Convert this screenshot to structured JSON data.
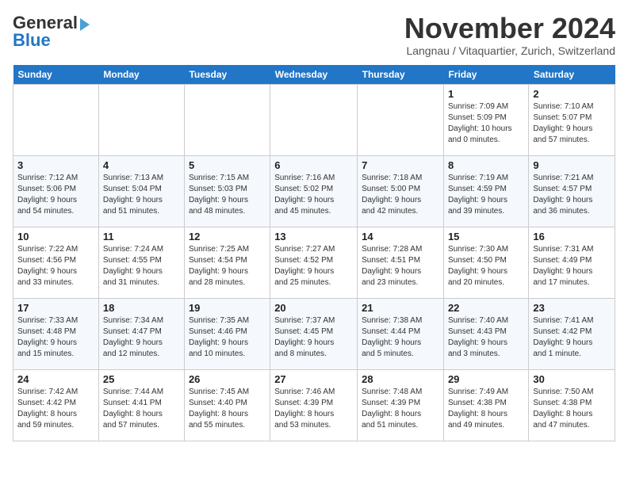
{
  "header": {
    "logo_line1": "General",
    "logo_line2": "Blue",
    "month": "November 2024",
    "location": "Langnau / Vitaquartier, Zurich, Switzerland"
  },
  "days_of_week": [
    "Sunday",
    "Monday",
    "Tuesday",
    "Wednesday",
    "Thursday",
    "Friday",
    "Saturday"
  ],
  "weeks": [
    [
      {
        "num": "",
        "info": ""
      },
      {
        "num": "",
        "info": ""
      },
      {
        "num": "",
        "info": ""
      },
      {
        "num": "",
        "info": ""
      },
      {
        "num": "",
        "info": ""
      },
      {
        "num": "1",
        "info": "Sunrise: 7:09 AM\nSunset: 5:09 PM\nDaylight: 10 hours\nand 0 minutes."
      },
      {
        "num": "2",
        "info": "Sunrise: 7:10 AM\nSunset: 5:07 PM\nDaylight: 9 hours\nand 57 minutes."
      }
    ],
    [
      {
        "num": "3",
        "info": "Sunrise: 7:12 AM\nSunset: 5:06 PM\nDaylight: 9 hours\nand 54 minutes."
      },
      {
        "num": "4",
        "info": "Sunrise: 7:13 AM\nSunset: 5:04 PM\nDaylight: 9 hours\nand 51 minutes."
      },
      {
        "num": "5",
        "info": "Sunrise: 7:15 AM\nSunset: 5:03 PM\nDaylight: 9 hours\nand 48 minutes."
      },
      {
        "num": "6",
        "info": "Sunrise: 7:16 AM\nSunset: 5:02 PM\nDaylight: 9 hours\nand 45 minutes."
      },
      {
        "num": "7",
        "info": "Sunrise: 7:18 AM\nSunset: 5:00 PM\nDaylight: 9 hours\nand 42 minutes."
      },
      {
        "num": "8",
        "info": "Sunrise: 7:19 AM\nSunset: 4:59 PM\nDaylight: 9 hours\nand 39 minutes."
      },
      {
        "num": "9",
        "info": "Sunrise: 7:21 AM\nSunset: 4:57 PM\nDaylight: 9 hours\nand 36 minutes."
      }
    ],
    [
      {
        "num": "10",
        "info": "Sunrise: 7:22 AM\nSunset: 4:56 PM\nDaylight: 9 hours\nand 33 minutes."
      },
      {
        "num": "11",
        "info": "Sunrise: 7:24 AM\nSunset: 4:55 PM\nDaylight: 9 hours\nand 31 minutes."
      },
      {
        "num": "12",
        "info": "Sunrise: 7:25 AM\nSunset: 4:54 PM\nDaylight: 9 hours\nand 28 minutes."
      },
      {
        "num": "13",
        "info": "Sunrise: 7:27 AM\nSunset: 4:52 PM\nDaylight: 9 hours\nand 25 minutes."
      },
      {
        "num": "14",
        "info": "Sunrise: 7:28 AM\nSunset: 4:51 PM\nDaylight: 9 hours\nand 23 minutes."
      },
      {
        "num": "15",
        "info": "Sunrise: 7:30 AM\nSunset: 4:50 PM\nDaylight: 9 hours\nand 20 minutes."
      },
      {
        "num": "16",
        "info": "Sunrise: 7:31 AM\nSunset: 4:49 PM\nDaylight: 9 hours\nand 17 minutes."
      }
    ],
    [
      {
        "num": "17",
        "info": "Sunrise: 7:33 AM\nSunset: 4:48 PM\nDaylight: 9 hours\nand 15 minutes."
      },
      {
        "num": "18",
        "info": "Sunrise: 7:34 AM\nSunset: 4:47 PM\nDaylight: 9 hours\nand 12 minutes."
      },
      {
        "num": "19",
        "info": "Sunrise: 7:35 AM\nSunset: 4:46 PM\nDaylight: 9 hours\nand 10 minutes."
      },
      {
        "num": "20",
        "info": "Sunrise: 7:37 AM\nSunset: 4:45 PM\nDaylight: 9 hours\nand 8 minutes."
      },
      {
        "num": "21",
        "info": "Sunrise: 7:38 AM\nSunset: 4:44 PM\nDaylight: 9 hours\nand 5 minutes."
      },
      {
        "num": "22",
        "info": "Sunrise: 7:40 AM\nSunset: 4:43 PM\nDaylight: 9 hours\nand 3 minutes."
      },
      {
        "num": "23",
        "info": "Sunrise: 7:41 AM\nSunset: 4:42 PM\nDaylight: 9 hours\nand 1 minute."
      }
    ],
    [
      {
        "num": "24",
        "info": "Sunrise: 7:42 AM\nSunset: 4:42 PM\nDaylight: 8 hours\nand 59 minutes."
      },
      {
        "num": "25",
        "info": "Sunrise: 7:44 AM\nSunset: 4:41 PM\nDaylight: 8 hours\nand 57 minutes."
      },
      {
        "num": "26",
        "info": "Sunrise: 7:45 AM\nSunset: 4:40 PM\nDaylight: 8 hours\nand 55 minutes."
      },
      {
        "num": "27",
        "info": "Sunrise: 7:46 AM\nSunset: 4:39 PM\nDaylight: 8 hours\nand 53 minutes."
      },
      {
        "num": "28",
        "info": "Sunrise: 7:48 AM\nSunset: 4:39 PM\nDaylight: 8 hours\nand 51 minutes."
      },
      {
        "num": "29",
        "info": "Sunrise: 7:49 AM\nSunset: 4:38 PM\nDaylight: 8 hours\nand 49 minutes."
      },
      {
        "num": "30",
        "info": "Sunrise: 7:50 AM\nSunset: 4:38 PM\nDaylight: 8 hours\nand 47 minutes."
      }
    ]
  ]
}
